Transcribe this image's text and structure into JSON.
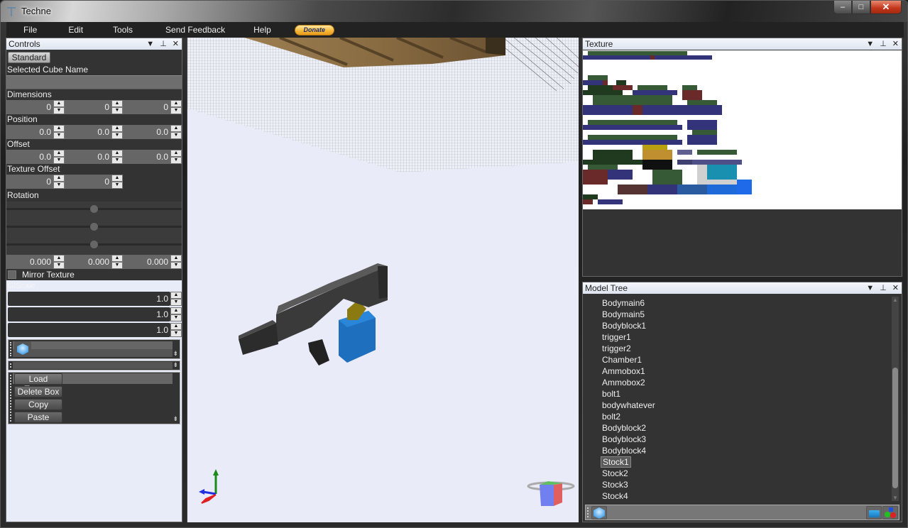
{
  "window": {
    "title": "Techne",
    "controls": {
      "minimize": "–",
      "maximize": "□",
      "close": "✕"
    }
  },
  "menu": {
    "items": [
      "File",
      "Edit",
      "Tools",
      "Send Feedback",
      "Help"
    ],
    "donate_label": "Donate"
  },
  "controls_panel": {
    "title": "Controls",
    "header_icons": {
      "dropdown": "▼",
      "pin": "⊥",
      "close": "✕"
    },
    "mode_button": "Standard",
    "selected_cube_name_label": "Selected Cube Name",
    "selected_cube_name_value": "",
    "dimensions": {
      "label": "Dimensions",
      "values": [
        "0",
        "0",
        "0"
      ]
    },
    "position": {
      "label": "Position",
      "values": [
        "0.0",
        "0.0",
        "0.0"
      ]
    },
    "offset": {
      "label": "Offset",
      "values": [
        "0.0",
        "0.0",
        "0.0"
      ]
    },
    "texture_offset": {
      "label": "Texture Offset",
      "values": [
        "0",
        "0"
      ]
    },
    "rotation": {
      "label": "Rotation",
      "slider_fractions": [
        0.5,
        0.5,
        0.5
      ],
      "values": [
        "0.000",
        "0.000",
        "0.000"
      ]
    },
    "mirror_texture": {
      "label": "Mirror Texture",
      "checked": false
    },
    "glscale": {
      "label": "GlScale",
      "values": [
        "1.0",
        "1.0",
        "1.0"
      ]
    },
    "actions": [
      "Load Texture",
      "Delete Box",
      "Copy",
      "Paste"
    ],
    "spin_up": "▲",
    "spin_down": "▼",
    "overflow_glyph": "⇟"
  },
  "texture_panel": {
    "title": "Texture",
    "header_icons": {
      "dropdown": "▼",
      "pin": "⊥",
      "close": "✕"
    }
  },
  "model_tree": {
    "title": "Model Tree",
    "header_icons": {
      "dropdown": "▼",
      "pin": "⊥",
      "close": "✕"
    },
    "items": [
      "Bodymain6",
      "Bodymain5",
      "Bodyblock1",
      "trigger1",
      "trigger2",
      "Chamber1",
      "Ammobox1",
      "Ammobox2",
      "bolt1",
      "bodywhatever",
      "bolt2",
      "Bodyblock2",
      "Bodyblock3",
      "Bodyblock4",
      "Stock1",
      "Stock2",
      "Stock3",
      "Stock4"
    ],
    "selected": "Stock1",
    "scroll_up": "▲",
    "scroll_down": "▼"
  },
  "viewport": {
    "colors": {
      "background": "#e9ebf8",
      "axis_x": "#e02020",
      "axis_y": "#1a8a1a",
      "axis_z": "#2030e0",
      "model_dark": "#3a3a3a",
      "ammo_blue": "#1f6fbf",
      "chamber_gold": "#8a7a10"
    }
  }
}
